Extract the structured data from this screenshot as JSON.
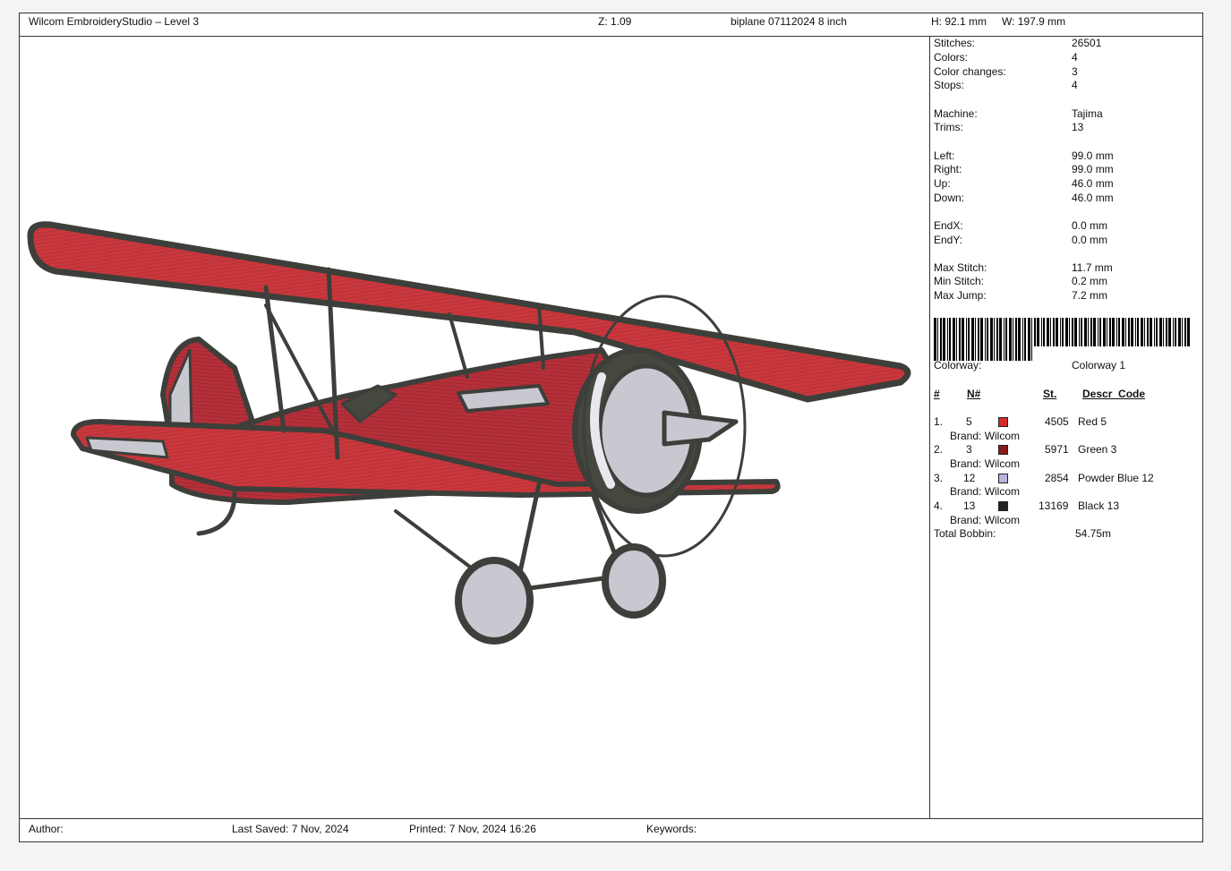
{
  "header": {
    "app_title": "Wilcom EmbroideryStudio – Level 3",
    "zoom": "Z: 1.09",
    "design_name": "biplane 07112024 8 inch",
    "height": "H: 92.1 mm",
    "width": "W: 197.9 mm"
  },
  "stats": {
    "stitches": {
      "label": "Stitches:",
      "value": "26501"
    },
    "colors": {
      "label": "Colors:",
      "value": "4"
    },
    "color_changes": {
      "label": "Color changes:",
      "value": "3"
    },
    "stops": {
      "label": "Stops:",
      "value": "4"
    },
    "machine": {
      "label": "Machine:",
      "value": "Tajima"
    },
    "trims": {
      "label": "Trims:",
      "value": "13"
    },
    "left": {
      "label": "Left:",
      "value": "99.0 mm"
    },
    "right": {
      "label": "Right:",
      "value": "99.0 mm"
    },
    "up": {
      "label": "Up:",
      "value": "46.0 mm"
    },
    "down": {
      "label": "Down:",
      "value": "46.0 mm"
    },
    "endx": {
      "label": "EndX:",
      "value": "0.0 mm"
    },
    "endy": {
      "label": "EndY:",
      "value": "0.0 mm"
    },
    "max_stitch": {
      "label": "Max Stitch:",
      "value": "11.7 mm"
    },
    "min_stitch": {
      "label": "Min Stitch:",
      "value": "0.2 mm"
    },
    "max_jump": {
      "label": "Max Jump:",
      "value": "7.2 mm"
    }
  },
  "colorway": {
    "label": "Colorway:",
    "value": "Colorway 1"
  },
  "thread_table": {
    "headers": {
      "num": "#",
      "n": "N#",
      "st": "St.",
      "descr": "Descr_Code"
    },
    "rows": [
      {
        "index": "1.",
        "n": "5",
        "color": "#d42a2a",
        "stitches": "4505",
        "descr": "Red 5",
        "brand": "Brand: Wilcom"
      },
      {
        "index": "2.",
        "n": "3",
        "color": "#8b1a1a",
        "stitches": "5971",
        "descr": "Green 3",
        "brand": "Brand: Wilcom"
      },
      {
        "index": "3.",
        "n": "12",
        "color": "#b8b4dc",
        "stitches": "2854",
        "descr": "Powder Blue 12",
        "brand": "Brand: Wilcom"
      },
      {
        "index": "4.",
        "n": "13",
        "color": "#222222",
        "stitches": "13169",
        "descr": "Black 13",
        "brand": "Brand: Wilcom"
      }
    ],
    "total_bobbin": {
      "label": "Total Bobbin:",
      "value": "54.75m"
    }
  },
  "footer": {
    "author_label": "Author:",
    "last_saved": "Last Saved:  7 Nov, 2024",
    "printed": "Printed:  7 Nov, 2024 16:26",
    "keywords_label": "Keywords:"
  }
}
